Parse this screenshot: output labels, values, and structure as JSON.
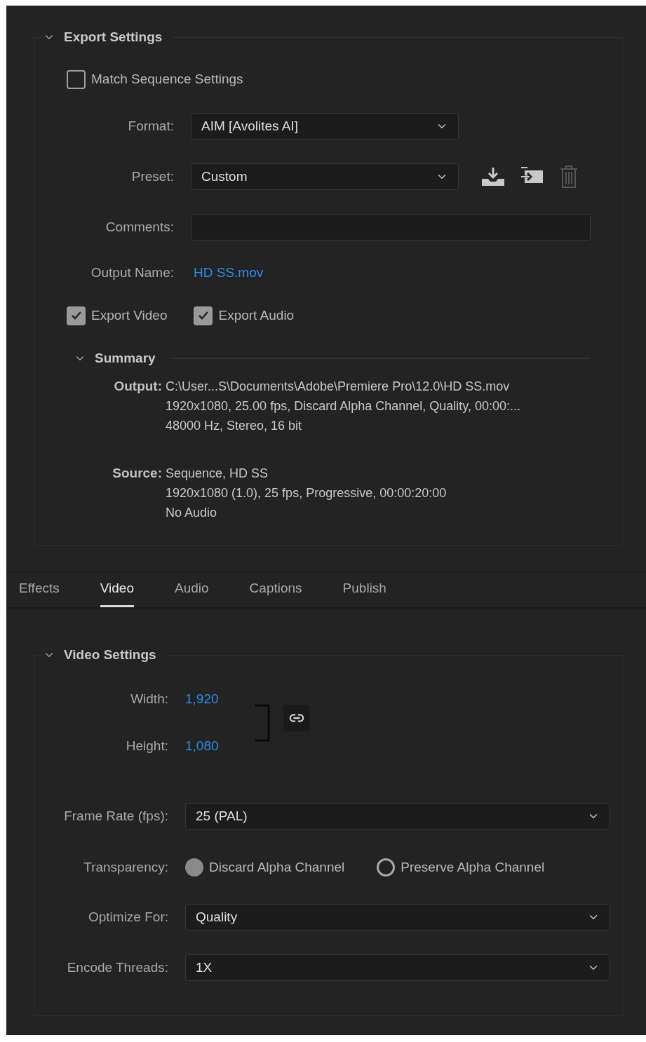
{
  "export_settings": {
    "title": "Export Settings",
    "expanded": true,
    "match_sequence": {
      "label": "Match Sequence Settings",
      "checked": false
    },
    "format": {
      "label": "Format:",
      "value": "AIM [Avolites AI]"
    },
    "preset": {
      "label": "Preset:",
      "value": "Custom"
    },
    "comments": {
      "label": "Comments:"
    },
    "output_name": {
      "label": "Output Name:",
      "value": "HD SS.mov"
    },
    "export_options": [
      {
        "label": "Export Video",
        "checked": true
      },
      {
        "label": "Export Audio",
        "checked": true
      }
    ],
    "summary": {
      "title": "Summary",
      "expanded": true,
      "entries": [
        {
          "label": "Output:",
          "lines": [
            "C:\\User...S\\Documents\\Adobe\\Premiere Pro\\12.0\\HD SS.mov",
            "1920x1080, 25.00 fps, Discard Alpha Channel, Quality, 00:00:...",
            "48000 Hz, Stereo, 16 bit"
          ]
        },
        {
          "label": "Source:",
          "lines": [
            "Sequence, HD SS",
            "1920x1080 (1.0), 25 fps, Progressive, 00:00:20:00",
            "No Audio"
          ]
        }
      ]
    }
  },
  "tabs": [
    {
      "label": "Effects",
      "selected": false
    },
    {
      "label": "Video",
      "selected": true
    },
    {
      "label": "Audio",
      "selected": false
    },
    {
      "label": "Captions",
      "selected": false
    },
    {
      "label": "Publish",
      "selected": false
    }
  ],
  "video_settings": {
    "title": "Video Settings",
    "expanded": true,
    "width": {
      "label": "Width:",
      "value": "1,920"
    },
    "height": {
      "label": "Height:",
      "value": "1,080"
    },
    "frame_rate": {
      "label": "Frame Rate (fps):",
      "value": "25 (PAL)"
    },
    "transparency": {
      "label": "Transparency:",
      "options": [
        {
          "label": "Discard Alpha Channel",
          "selected": true
        },
        {
          "label": "Preserve Alpha Channel",
          "selected": false
        }
      ]
    },
    "optimize_for": {
      "label": "Optimize For:",
      "value": "Quality"
    },
    "encode_threads": {
      "label": "Encode Threads:",
      "value": "1X"
    }
  }
}
